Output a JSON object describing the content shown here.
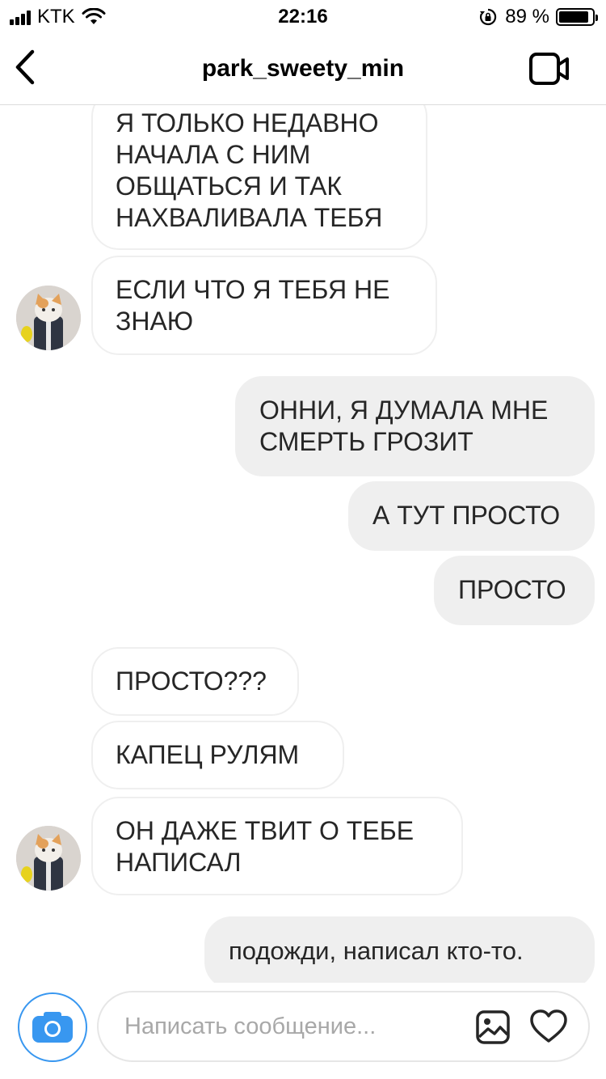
{
  "status_bar": {
    "carrier": "KTK",
    "time": "22:16",
    "battery_percent": "89 %",
    "battery_level": 0.89
  },
  "header": {
    "title": "park_sweety_min",
    "back_icon": "chevron-left-icon",
    "video_icon": "video-camera-icon"
  },
  "messages": [
    {
      "direction": "incoming",
      "text": "Я ТОЛЬКО НЕДАВНО\nНАЧАЛА С НИМ\nОБЩАТЬСЯ И ТАК\nНАХВАЛИВАЛА ТЕБЯ"
    },
    {
      "direction": "incoming",
      "text": "ЕСЛИ ЧТО Я ТЕБЯ НЕ\nЗНАЮ",
      "avatar": true
    },
    {
      "direction": "outgoing",
      "text": "ОННИ, Я ДУМАЛА МНЕ\nСМЕРТЬ ГРОЗИТ"
    },
    {
      "direction": "outgoing",
      "text": "А ТУТ ПРОСТО"
    },
    {
      "direction": "outgoing",
      "text": "ПРОСТО"
    },
    {
      "direction": "incoming",
      "text": "ПРОСТО???"
    },
    {
      "direction": "incoming",
      "text": "КАПЕЦ РУЛЯМ"
    },
    {
      "direction": "incoming",
      "text": "ОН ДАЖЕ ТВИТ О ТЕБЕ\nНАПИСАЛ",
      "avatar": true
    },
    {
      "direction": "outgoing",
      "text": "подожди, написал кто-то."
    }
  ],
  "composer": {
    "placeholder": "Написать сообщение...",
    "camera_icon": "camera-icon",
    "gallery_icon": "gallery-icon",
    "heart_icon": "heart-icon"
  },
  "colors": {
    "accent": "#3897f0",
    "outgoing_bubble": "#efefef",
    "incoming_border": "#efefef"
  }
}
